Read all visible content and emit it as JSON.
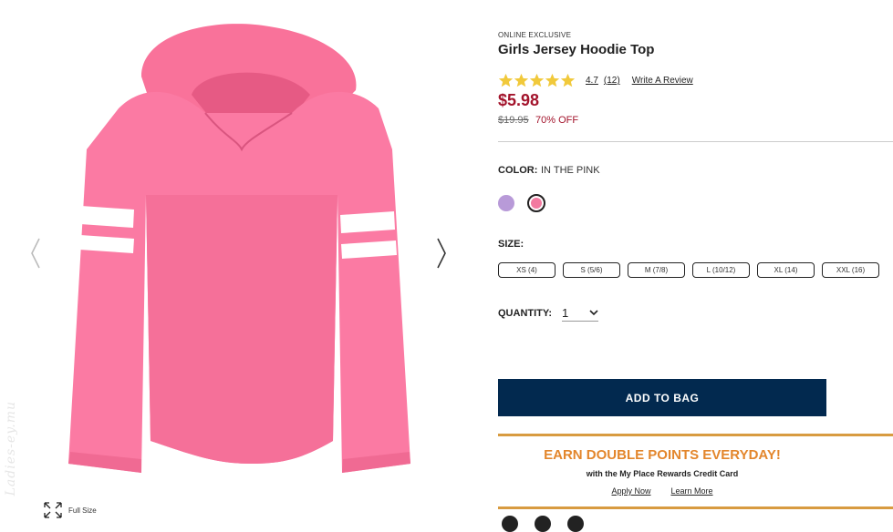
{
  "product": {
    "badge": "ONLINE EXCLUSIVE",
    "title": "Girls Jersey Hoodie Top",
    "rating": "4.7",
    "rating_fraction": 0.94,
    "review_count": "(12)",
    "write_review": "Write A Review",
    "price": "$5.98",
    "original_price": "$19.95",
    "discount": "70% OFF"
  },
  "gallery": {
    "fullsize_label": "Full Size",
    "watermark": "Ladies-ey.mu",
    "prev_icon": "chevron-left-icon",
    "next_icon": "chevron-right-icon"
  },
  "color": {
    "label": "COLOR:",
    "value": "IN THE PINK",
    "swatches": [
      {
        "name": "lavender",
        "hex": "#b89ad8",
        "selected": false
      },
      {
        "name": "pink",
        "hex": "#f27aa0",
        "selected": true
      }
    ]
  },
  "size": {
    "label": "SIZE:",
    "options": [
      "XS (4)",
      "S (5/6)",
      "M (7/8)",
      "L (10/12)",
      "XL (14)",
      "XXL (16)"
    ]
  },
  "quantity": {
    "label": "QUANTITY:",
    "value": "1"
  },
  "add_to_bag": "ADD TO BAG",
  "promo": {
    "headline": "EARN DOUBLE POINTS EVERYDAY!",
    "subtext": "with the My Place Rewards Credit Card",
    "apply": "Apply Now",
    "learn": "Learn More"
  },
  "colors": {
    "price_red": "#a3142c",
    "navy": "#02294f",
    "promo_orange": "#e3862c",
    "star_yellow": "#f1c93b"
  }
}
